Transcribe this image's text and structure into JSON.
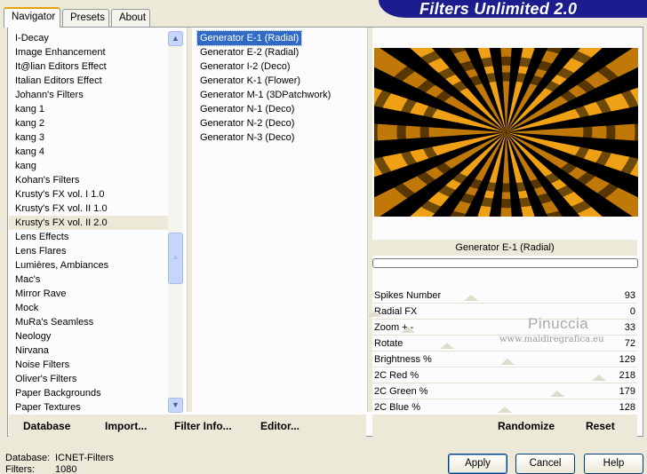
{
  "tabs": [
    "Navigator",
    "Presets",
    "About"
  ],
  "banner_title": "Filters Unlimited 2.0",
  "filter_categories": [
    "I-Decay",
    "Image Enhancement",
    "It@lian Editors Effect",
    "Italian Editors Effect",
    "Johann's Filters",
    "kang 1",
    "kang 2",
    "kang 3",
    "kang 4",
    "kang",
    "Kohan's Filters",
    "Krusty's FX vol. I 1.0",
    "Krusty's FX vol. II 1.0",
    "Krusty's FX vol. II 2.0",
    "Lens Effects",
    "Lens Flares",
    "Lumières, Ambiances",
    "Mac's",
    "Mirror Rave",
    "Mock",
    "MuRa's Seamless",
    "Neology",
    "Nirvana",
    "Noise Filters",
    "Oliver's Filters",
    "Paper Backgrounds",
    "Paper Textures"
  ],
  "selected_category_index": 13,
  "effects": [
    "Generator E-1 (Radial)",
    "Generator E-2 (Radial)",
    "Generator I-2 (Deco)",
    "Generator K-1 (Flower)",
    "Generator M-1 (3DPatchwork)",
    "Generator N-1 (Deco)",
    "Generator N-2 (Deco)",
    "Generator N-3 (Deco)"
  ],
  "selected_effect_index": 0,
  "preview": {
    "effect_name": "Generator E-1 (Radial)",
    "colors": {
      "dark": "#000000",
      "orange": "#f0a015",
      "amber": "#c07808"
    }
  },
  "sliders": [
    {
      "label": "Spikes Number",
      "value": "93",
      "level": 0.37
    },
    {
      "label": "Radial FX",
      "value": "0",
      "level": 0.0
    },
    {
      "label": "Zoom + -",
      "value": "33",
      "level": 0.13
    },
    {
      "label": "Rotate",
      "value": "72",
      "level": 0.28
    },
    {
      "label": "Brightness %",
      "value": "129",
      "level": 0.51
    },
    {
      "label": "2C Red %",
      "value": "218",
      "level": 0.86
    },
    {
      "label": "2C Green %",
      "value": "179",
      "level": 0.7
    },
    {
      "label": "2C Blue %",
      "value": "128",
      "level": 0.5
    }
  ],
  "watermark": {
    "name": "Pinuccia",
    "url": "www.maidiregrafica.eu"
  },
  "toolbar": {
    "database": "Database",
    "import": "Import...",
    "filter_info": "Filter Info...",
    "editor": "Editor...",
    "randomize": "Randomize",
    "reset": "Reset"
  },
  "status": {
    "database_label": "Database:",
    "database_value": "ICNET-Filters",
    "filters_label": "Filters:",
    "filters_value": "1080"
  },
  "buttons": {
    "apply": "Apply",
    "cancel": "Cancel",
    "help": "Help"
  }
}
